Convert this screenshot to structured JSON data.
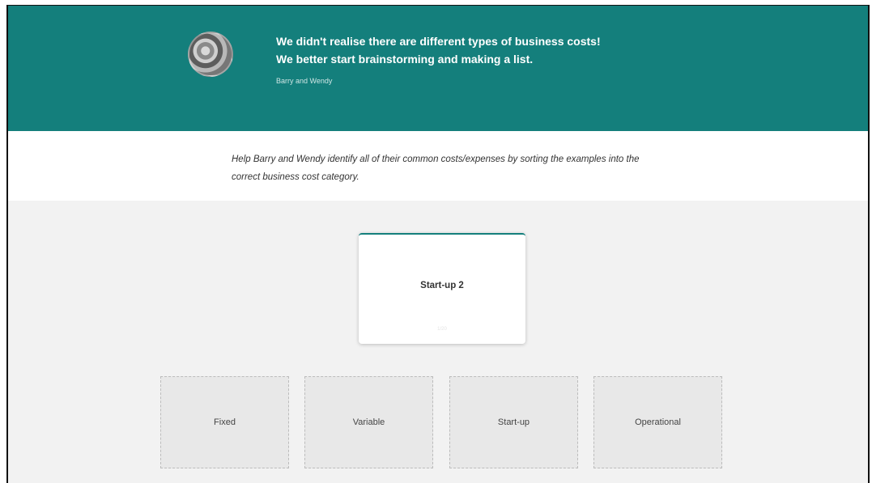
{
  "header": {
    "quote_line_1": "We didn't realise there are different types of business costs!",
    "quote_line_2": "We better start brainstorming and making a list.",
    "attribution": "Barry and Wendy",
    "background_color": "#147f7c",
    "avatar_icon": "profile-photo"
  },
  "instruction": {
    "text": "Help Barry and Wendy identify all of their common costs/expenses by sorting the examples into the correct business cost category."
  },
  "card": {
    "label": "Start-up 2",
    "counter": "1/20"
  },
  "drop_zones": [
    {
      "label": "Fixed"
    },
    {
      "label": "Variable"
    },
    {
      "label": "Start-up"
    },
    {
      "label": "Operational"
    }
  ]
}
